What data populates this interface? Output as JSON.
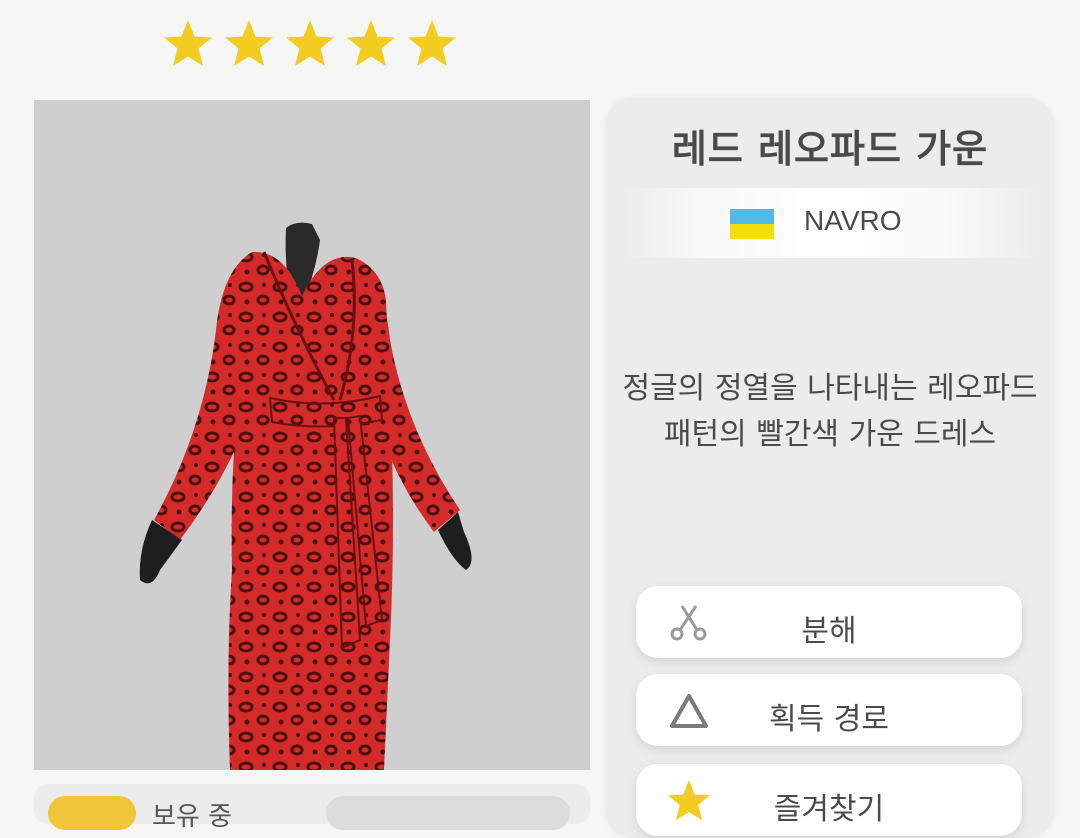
{
  "rating": {
    "stars": 5,
    "max": 5,
    "color": "#f2cc1f"
  },
  "item": {
    "title": "레드 레오파드 가운",
    "brand": "NAVRO",
    "brand_flag": "ukraine-flag",
    "description_line1": "정글의 정열을 나타내는 레오파드",
    "description_line2": "패턴의 빨간색 가운 드레스"
  },
  "actions": {
    "disassemble_label": "분해",
    "acquire_route_label": "획득 경로",
    "favorite_label": "즐겨찾기"
  },
  "owned": {
    "label": "보유 중"
  },
  "colors": {
    "star": "#f2cc1f",
    "gown": "#d42a2a",
    "panel": "#ececec",
    "accent_pill": "#f0c53a"
  }
}
